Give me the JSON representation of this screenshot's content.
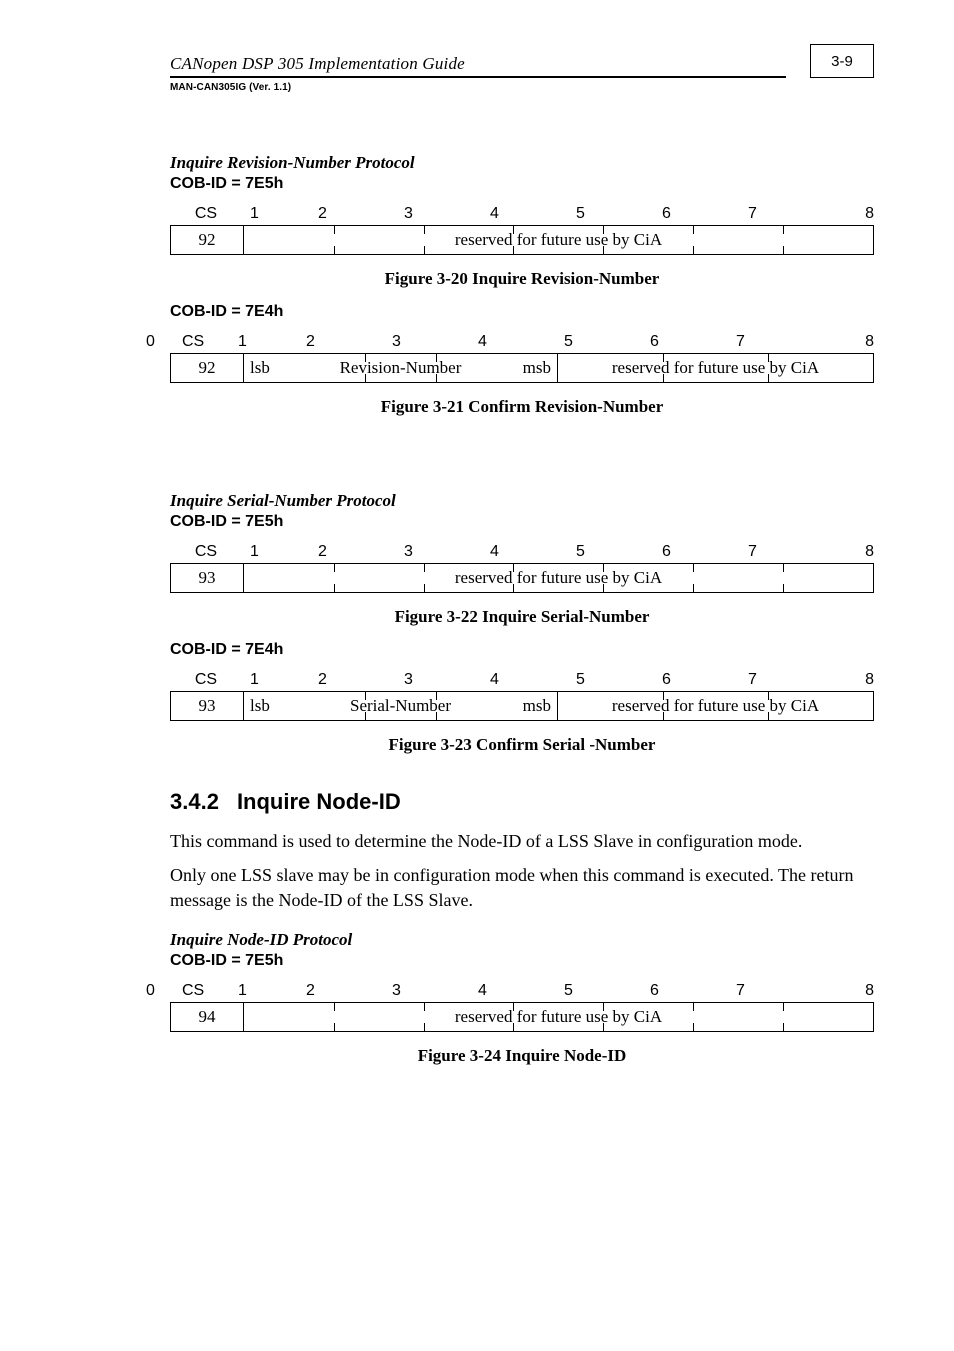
{
  "header": {
    "title": "CANopen DSP 305 Implementation Guide",
    "sub": "MAN-CAN305IG (Ver. 1.1)",
    "pagenum": "3-9"
  },
  "proto1": {
    "title": "Inquire Revision-Number Protocol",
    "cob1": "COB-ID = 7E5h",
    "cob2": "COB-ID = 7E4h",
    "numcs": "CS",
    "n1": "1",
    "n2": "2",
    "n3": "3",
    "n4": "4",
    "n5": "5",
    "n6": "6",
    "n7": "7",
    "n8": "8",
    "zero": "0",
    "cs1": "92",
    "cs2": "92",
    "reserved": "reserved for future use by CiA",
    "lsb": "lsb",
    "revnum": "Revision-Number",
    "msb": "msb",
    "reserved2": "reserved for future use by CiA",
    "figA": "Figure 3-20  Inquire Revision-Number",
    "figB": "Figure 3-21  Confirm Revision-Number"
  },
  "proto2": {
    "title": "Inquire Serial-Number Protocol",
    "cob1": "COB-ID = 7E5h",
    "cob2": "COB-ID = 7E4h",
    "numcs": "CS",
    "n1": "1",
    "n2": "2",
    "n3": "3",
    "n4": "4",
    "n5": "5",
    "n6": "6",
    "n7": "7",
    "n8": "8",
    "cs1": "93",
    "cs2": "93",
    "reserved": "reserved for future use by CiA",
    "lsb": "lsb",
    "sernum": "Serial-Number",
    "msb": "msb",
    "reserved2": "reserved for future use by CiA",
    "figA": "Figure 3-22  Inquire Serial-Number",
    "figB": "Figure 3-23  Confirm Serial -Number"
  },
  "section": {
    "num": "3.4.2",
    "title": "Inquire Node-ID",
    "p1": "This command is used to determine the Node-ID of a LSS Slave in configuration mode.",
    "p2": "Only one LSS slave may be in configuration mode when this command is executed. The return message is the Node-ID of the LSS Slave."
  },
  "proto3": {
    "title": "Inquire Node-ID  Protocol",
    "cob1": "COB-ID = 7E5h",
    "numcs": "CS",
    "zero": "0",
    "n1": "1",
    "n2": "2",
    "n3": "3",
    "n4": "4",
    "n5": "5",
    "n6": "6",
    "n7": "7",
    "n8": "8",
    "cs1": "94",
    "reserved": "reserved for future use by CiA",
    "figA": "Figure 3-24  Inquire Node-ID"
  }
}
